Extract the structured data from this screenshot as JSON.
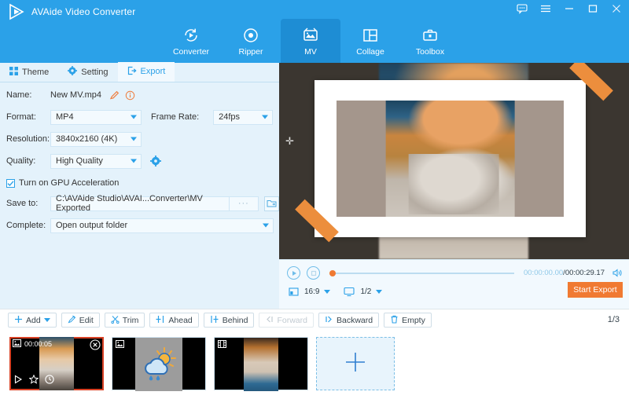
{
  "header": {
    "app_title": "AVAide Video Converter",
    "window_controls": [
      {
        "name": "feedback-icon",
        "glyph": "comment"
      },
      {
        "name": "menu-icon",
        "glyph": "hamburger"
      },
      {
        "name": "minimize-icon",
        "glyph": "minimize"
      },
      {
        "name": "maximize-icon",
        "glyph": "maximize"
      },
      {
        "name": "close-icon",
        "glyph": "close"
      }
    ],
    "nav_tabs": [
      {
        "label": "Converter",
        "icon": "converter-icon",
        "active": false
      },
      {
        "label": "Ripper",
        "icon": "ripper-icon",
        "active": false
      },
      {
        "label": "MV",
        "icon": "mv-icon",
        "active": true
      },
      {
        "label": "Collage",
        "icon": "collage-icon",
        "active": false
      },
      {
        "label": "Toolbox",
        "icon": "toolbox-icon",
        "active": false
      }
    ]
  },
  "left_panel": {
    "tabs": [
      {
        "label": "Theme",
        "icon": "grid-icon",
        "active": false
      },
      {
        "label": "Setting",
        "icon": "gear-icon",
        "active": false
      },
      {
        "label": "Export",
        "icon": "export-icon",
        "active": true
      }
    ],
    "fields": {
      "name_label": "Name:",
      "name_value": "New MV.mp4",
      "format_label": "Format:",
      "format_value": "MP4",
      "framerate_label": "Frame Rate:",
      "framerate_value": "24fps",
      "resolution_label": "Resolution:",
      "resolution_value": "3840x2160 (4K)",
      "quality_label": "Quality:",
      "quality_value": "High Quality",
      "gpu_label": "Turn on GPU Acceleration",
      "gpu_checked": true,
      "saveto_label": "Save to:",
      "saveto_value": "C:\\AVAide Studio\\AVAI...Converter\\MV Exported",
      "browse_dots": "···",
      "complete_label": "Complete:",
      "complete_value": "Open output folder"
    },
    "start_export_label": "Start Export"
  },
  "player": {
    "current_time": "00:00:00.00",
    "separator": "/",
    "total_time": "00:00:29.17",
    "aspect_ratio": "16:9",
    "split_value": "1/2",
    "export_label": "Start Export",
    "progress_percent": 0
  },
  "toolbar": {
    "buttons": [
      {
        "label": "Add",
        "icon": "plus-icon",
        "disabled": false,
        "has_caret": true
      },
      {
        "label": "Edit",
        "icon": "edit-icon",
        "disabled": false,
        "has_caret": false
      },
      {
        "label": "Trim",
        "icon": "scissors-icon",
        "disabled": false,
        "has_caret": false
      },
      {
        "label": "Ahead",
        "icon": "insert-ahead-icon",
        "disabled": false,
        "has_caret": false
      },
      {
        "label": "Behind",
        "icon": "insert-behind-icon",
        "disabled": false,
        "has_caret": false
      },
      {
        "label": "Forward",
        "icon": "move-forward-icon",
        "disabled": true,
        "has_caret": false
      },
      {
        "label": "Backward",
        "icon": "move-backward-icon",
        "disabled": false,
        "has_caret": false
      },
      {
        "label": "Empty",
        "icon": "trash-icon",
        "disabled": false,
        "has_caret": false
      }
    ],
    "page_indicator": "1/3"
  },
  "thumbnails": [
    {
      "kind": "image",
      "duration": "00:00:05",
      "selected": true,
      "badge_icon": "image-icon"
    },
    {
      "kind": "image",
      "duration": "",
      "selected": false,
      "badge_icon": "image-icon"
    },
    {
      "kind": "video",
      "duration": "",
      "selected": false,
      "badge_icon": "film-icon"
    }
  ],
  "add_tile": {
    "icon": "plus-icon"
  },
  "colors": {
    "brand_blue": "#2ba1e8",
    "panel_blue": "#e4f2fb",
    "accent_orange": "#ee7d3d",
    "annotation_red": "#c4122f",
    "annotation_fill": "#c9c0e0"
  }
}
